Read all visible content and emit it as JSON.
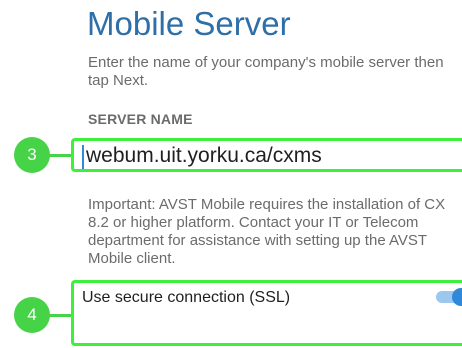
{
  "header": {
    "title": "Mobile Server",
    "intro": "Enter the name of your company's mobile server then tap Next."
  },
  "server": {
    "label": "SERVER NAME",
    "value": "webum.uit.yorku.ca/cxms"
  },
  "notice": {
    "text": "Important: AVST Mobile requires the installation of CX 8.2 or higher platform. Contact your IT or Telecom department for assistance with setting up the AVST Mobile client."
  },
  "ssl": {
    "label": "Use secure connection (SSL)",
    "enabled": true
  },
  "steps": {
    "server_step": "3",
    "ssl_step": "4"
  },
  "colors": {
    "title": "#2f6fa8",
    "highlight": "#3cf03c",
    "badge": "#47d347",
    "toggle_on": "#2f88d8"
  }
}
